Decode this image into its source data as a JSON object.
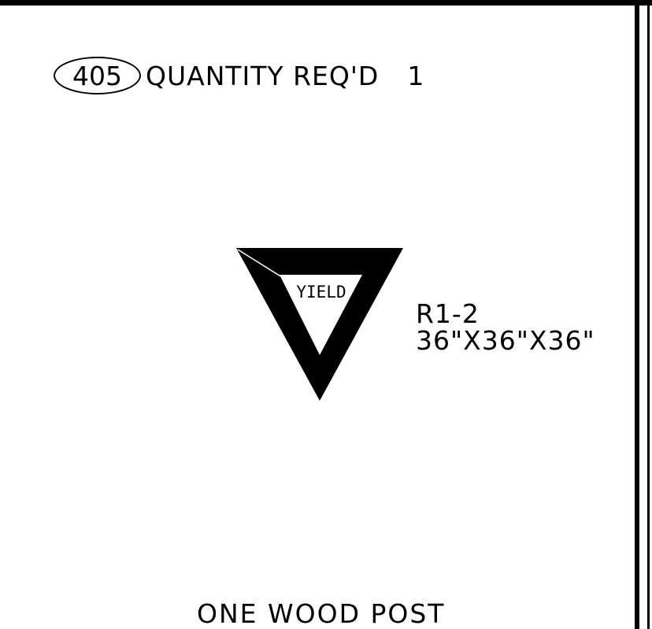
{
  "sign": {
    "number": "405",
    "quantity_label": "QUANTITY REQ'D",
    "quantity_value": "1",
    "legend": "YIELD",
    "code": "R1-2",
    "size": "36\"X36\"X36\"",
    "mounting": "ONE WOOD POST",
    "icon": "yield-sign-icon"
  },
  "colors": {
    "ink": "#000000",
    "background": "#ffffff"
  }
}
